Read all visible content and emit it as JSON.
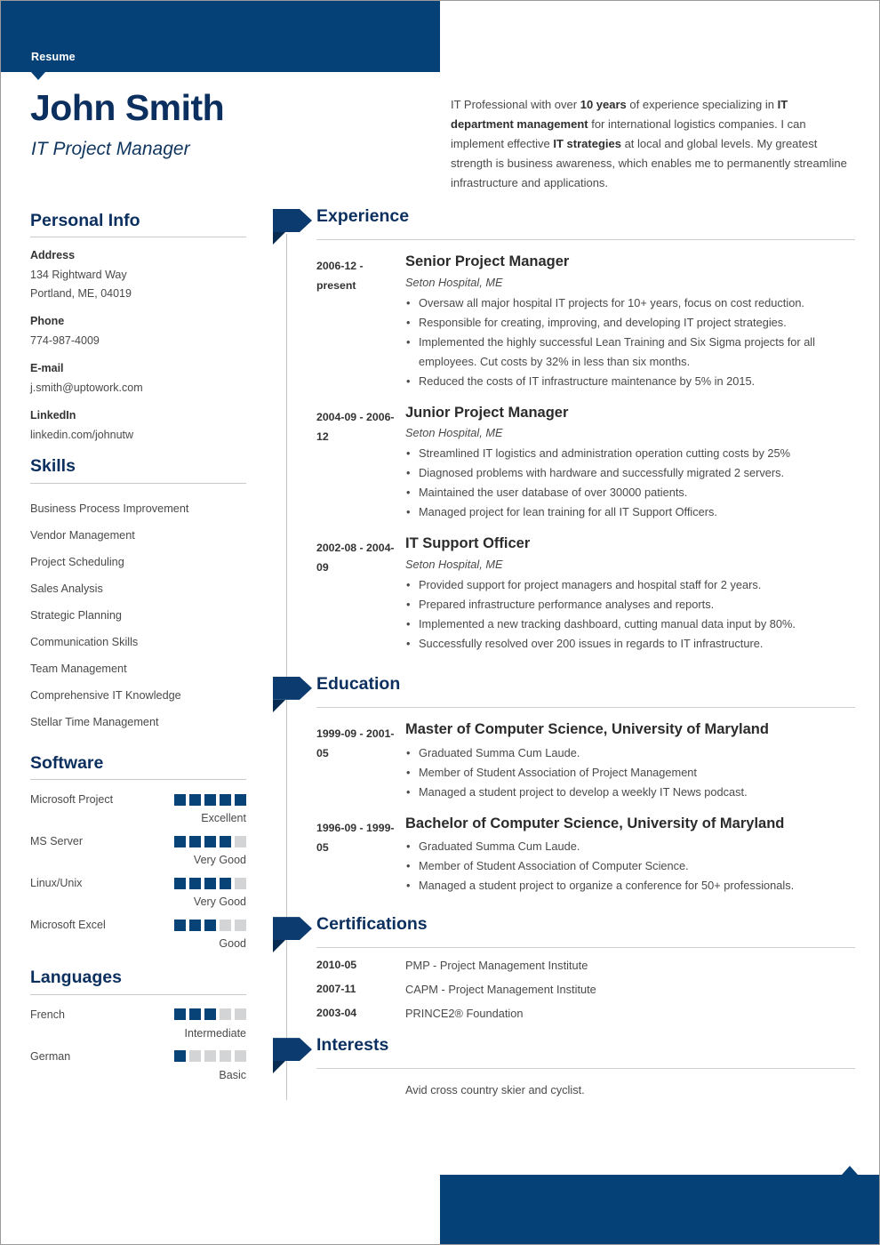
{
  "document": {
    "header_label": "Resume",
    "name": "John Smith",
    "job_title": "IT Project Manager",
    "accent_color": "#054076",
    "heading_color": "#0b2f5e",
    "rating_on_color": "#084377",
    "rating_off_color": "#d2d4d6"
  },
  "summary": {
    "segments": [
      {
        "text": "IT Professional with over ",
        "bold": false
      },
      {
        "text": "10 years",
        "bold": true
      },
      {
        "text": " of experience specializing in ",
        "bold": false
      },
      {
        "text": "IT department management",
        "bold": true
      },
      {
        "text": " for international logistics companies. I can implement effective ",
        "bold": false
      },
      {
        "text": "IT strategies",
        "bold": true
      },
      {
        "text": " at local and global levels. My greatest strength is business awareness, which enables me to permanently streamline infrastructure and applications.",
        "bold": false
      }
    ]
  },
  "sidebar": {
    "personal_info": {
      "title": "Personal Info",
      "fields": [
        {
          "label": "Address",
          "value": "134 Rightward Way\nPortland, ME, 04019"
        },
        {
          "label": "Phone",
          "value": "774-987-4009"
        },
        {
          "label": "E-mail",
          "value": "j.smith@uptowork.com"
        },
        {
          "label": "LinkedIn",
          "value": "linkedin.com/johnutw"
        }
      ]
    },
    "skills": {
      "title": "Skills",
      "items": [
        "Business Process Improvement",
        "Vendor Management",
        "Project Scheduling",
        "Sales Analysis",
        "Strategic Planning",
        "Communication Skills",
        "Team Management",
        "Comprehensive IT Knowledge",
        "Stellar Time Management"
      ]
    },
    "software": {
      "title": "Software",
      "max_rating": 5,
      "items": [
        {
          "name": "Microsoft Project",
          "rating": 5,
          "level": "Excellent"
        },
        {
          "name": "MS Server",
          "rating": 4,
          "level": "Very Good"
        },
        {
          "name": "Linux/Unix",
          "rating": 4,
          "level": "Very Good"
        },
        {
          "name": "Microsoft Excel",
          "rating": 3,
          "level": "Good"
        }
      ]
    },
    "languages": {
      "title": "Languages",
      "max_rating": 5,
      "items": [
        {
          "name": "French",
          "rating": 3,
          "level": "Intermediate"
        },
        {
          "name": "German",
          "rating": 1,
          "level": "Basic"
        }
      ]
    }
  },
  "main": {
    "experience": {
      "title": "Experience",
      "entries": [
        {
          "date": "2006-12 - present",
          "role": "Senior Project Manager",
          "organization": "Seton Hospital, ME",
          "bullets": [
            "Oversaw all major hospital IT projects for 10+ years, focus on cost reduction.",
            "Responsible for creating, improving, and developing IT project strategies.",
            "Implemented the highly successful Lean Training and Six Sigma projects for all employees. Cut costs by 32% in less than six months.",
            "Reduced the costs of IT infrastructure maintenance by 5% in 2015."
          ]
        },
        {
          "date": "2004-09 - 2006-12",
          "role": "Junior Project Manager",
          "organization": "Seton Hospital, ME",
          "bullets": [
            "Streamlined IT logistics and administration operation cutting costs by 25%",
            "Diagnosed problems with hardware and successfully migrated 2 servers.",
            "Maintained the user database of over 30000 patients.",
            "Managed project for lean training for all IT Support Officers."
          ]
        },
        {
          "date": "2002-08 - 2004-09",
          "role": "IT Support Officer",
          "organization": "Seton Hospital, ME",
          "bullets": [
            "Provided support for project managers and hospital staff for 2 years.",
            "Prepared infrastructure performance analyses and reports.",
            "Implemented a new tracking dashboard, cutting manual data input by 80%.",
            "Successfully resolved over 200 issues in regards to IT infrastructure."
          ]
        }
      ]
    },
    "education": {
      "title": "Education",
      "entries": [
        {
          "date": "1999-09 - 2001-05",
          "role": "Master of Computer Science, University of Maryland",
          "organization": "",
          "bullets": [
            "Graduated Summa Cum Laude.",
            "Member of Student Association of Project Management",
            "Managed a student project to develop a weekly IT News podcast."
          ]
        },
        {
          "date": "1996-09 - 1999-05",
          "role": "Bachelor of Computer Science, University of Maryland",
          "organization": "",
          "bullets": [
            "Graduated Summa Cum Laude.",
            "Member of Student Association of Computer Science.",
            "Managed a student project to organize a conference for 50+ professionals."
          ]
        }
      ]
    },
    "certifications": {
      "title": "Certifications",
      "entries": [
        {
          "date": "2010-05",
          "text": "PMP - Project Management Institute"
        },
        {
          "date": "2007-11",
          "text": "CAPM - Project Management Institute"
        },
        {
          "date": "2003-04",
          "text": "PRINCE2® Foundation"
        }
      ]
    },
    "interests": {
      "title": "Interests",
      "text": "Avid cross country skier and cyclist."
    }
  }
}
